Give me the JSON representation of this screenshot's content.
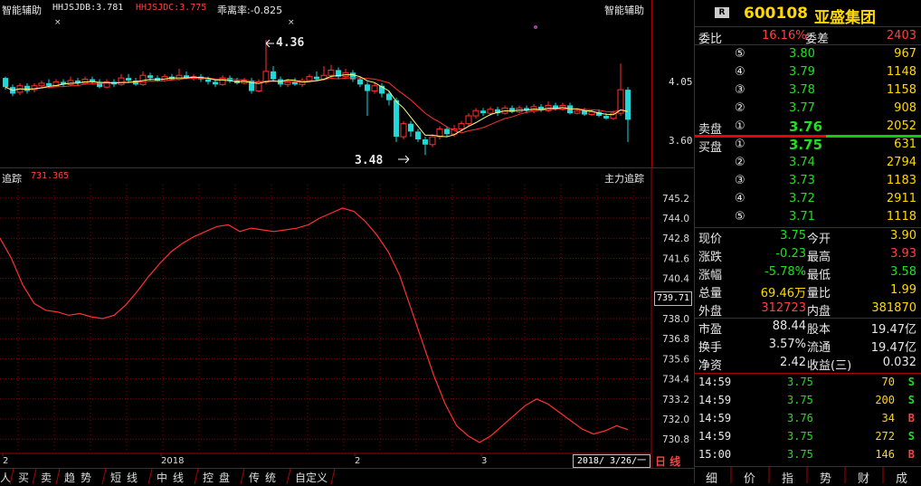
{
  "top_chart": {
    "title_left": "智能辅助",
    "indicator_1": "HHJSJDB:3.781",
    "indicator_2": "HHJSJDC:3.775",
    "indicator_3": "乖离率:-0.825",
    "title_right": "智能辅助",
    "high_label": "4.36",
    "low_label": "3.48",
    "y_ticks": [
      "4.05",
      "3.60"
    ]
  },
  "bottom_chart": {
    "title_left": "追踪",
    "value_label": "731.365",
    "title_right": "主力追踪",
    "current_value": "739.71",
    "date_box": "2018/ 3/26/一",
    "period": "日 线"
  },
  "chart_data": [
    {
      "type": "line",
      "title": "主力追踪",
      "ylim": [
        730.0,
        746.0
      ],
      "y_ticks": [
        745.2,
        744.0,
        742.8,
        741.6,
        740.4,
        739.2,
        738.0,
        736.8,
        735.6,
        734.4,
        733.2,
        732.0,
        730.8
      ],
      "x_ticks": [
        "2",
        "2018",
        "2",
        "3"
      ],
      "series": [
        {
          "values": [
            742.8,
            741.6,
            740.0,
            738.9,
            738.5,
            738.4,
            738.2,
            738.3,
            738.1,
            738.0,
            738.2,
            738.8,
            739.6,
            740.5,
            741.3,
            742.0,
            742.5,
            742.9,
            743.2,
            743.5,
            743.6,
            743.2,
            743.4,
            743.3,
            743.2,
            743.3,
            743.4,
            743.6,
            744.0,
            744.3,
            744.6,
            744.4,
            743.8,
            743.0,
            742.0,
            740.6,
            738.6,
            736.6,
            734.6,
            732.9,
            731.6,
            731.0,
            730.6,
            731.0,
            731.6,
            732.2,
            732.8,
            733.2,
            732.9,
            732.4,
            731.9,
            731.4,
            731.1,
            731.3,
            731.6,
            731.365
          ]
        }
      ]
    }
  ],
  "bottom_tabs": [
    "人",
    "买",
    "卖",
    "趋势",
    "短线",
    "中线",
    "控盘",
    "传统",
    "自定义"
  ],
  "quote": {
    "code": "600108",
    "name": "亚盛集团",
    "wb_label": "委比",
    "wb_value": "16.16%",
    "wc_label": "委差",
    "wc_value": "2403",
    "sell_label": "卖盘",
    "buy_label": "买盘",
    "sell": [
      {
        "idx": "⑤",
        "price": "3.80",
        "vol": "967"
      },
      {
        "idx": "④",
        "price": "3.79",
        "vol": "1148"
      },
      {
        "idx": "③",
        "price": "3.78",
        "vol": "1158"
      },
      {
        "idx": "②",
        "price": "3.77",
        "vol": "908"
      },
      {
        "idx": "①",
        "price": "3.76",
        "vol": "2052"
      }
    ],
    "buy": [
      {
        "idx": "①",
        "price": "3.75",
        "vol": "631"
      },
      {
        "idx": "②",
        "price": "3.74",
        "vol": "2794"
      },
      {
        "idx": "③",
        "price": "3.73",
        "vol": "1183"
      },
      {
        "idx": "④",
        "price": "3.72",
        "vol": "2911"
      },
      {
        "idx": "⑤",
        "price": "3.71",
        "vol": "1118"
      }
    ],
    "stats": [
      {
        "l1": "现价",
        "v1": "3.75",
        "l2": "今开",
        "v2": "3.90"
      },
      {
        "l1": "涨跌",
        "v1": "-0.23",
        "l2": "最高",
        "v2": "3.93"
      },
      {
        "l1": "涨幅",
        "v1": "-5.78%",
        "l2": "最低",
        "v2": "3.58"
      },
      {
        "l1": "总量",
        "v1": "69.46万",
        "l2": "量比",
        "v2": "1.99"
      },
      {
        "l1": "外盘",
        "v1": "312723",
        "l2": "内盘",
        "v2": "381870"
      }
    ],
    "fin": [
      {
        "l1": "市盈",
        "v1": "88.44",
        "l2": "股本",
        "v2": "19.47亿"
      },
      {
        "l1": "换手",
        "v1": "3.57%",
        "l2": "流通",
        "v2": "19.47亿"
      },
      {
        "l1": "净资",
        "v1": "2.42",
        "l2": "收益(三)",
        "v2": "0.032"
      }
    ],
    "ticks": [
      {
        "time": "14:59",
        "price": "3.75",
        "vol": "70",
        "side": "S"
      },
      {
        "time": "14:59",
        "price": "3.75",
        "vol": "200",
        "side": "S"
      },
      {
        "time": "14:59",
        "price": "3.76",
        "vol": "34",
        "side": "B"
      },
      {
        "time": "14:59",
        "price": "3.75",
        "vol": "272",
        "side": "S"
      },
      {
        "time": "15:00",
        "price": "3.75",
        "vol": "146",
        "side": "B"
      }
    ],
    "tabs": [
      "细",
      "价",
      "指",
      "势",
      "财",
      "成"
    ]
  },
  "colors": {
    "up": "#ff3030",
    "down": "#21d7d7",
    "grid": "#8b0000",
    "line": "#ff3030",
    "ma1": "#ffff80",
    "ma2": "#ff3030"
  }
}
